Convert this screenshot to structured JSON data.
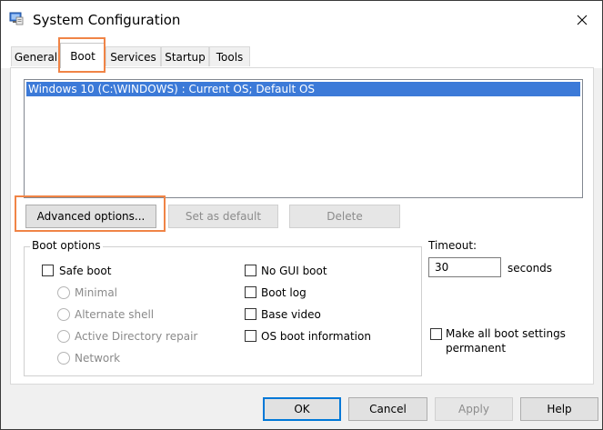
{
  "window": {
    "title": "System Configuration",
    "app_icon": "msconfig-icon",
    "close_icon": "close-icon"
  },
  "tabs": [
    {
      "label": "General",
      "active": false
    },
    {
      "label": "Boot",
      "active": true
    },
    {
      "label": "Services",
      "active": false
    },
    {
      "label": "Startup",
      "active": false
    },
    {
      "label": "Tools",
      "active": false
    }
  ],
  "os_list": {
    "entries": [
      "Windows 10 (C:\\WINDOWS) : Current OS; Default OS"
    ],
    "selected_index": 0
  },
  "buttons": {
    "advanced": "Advanced options...",
    "set_default": "Set as default",
    "delete": "Delete"
  },
  "boot_options": {
    "label": "Boot options",
    "safe_boot": {
      "label": "Safe boot",
      "checked": false
    },
    "radios": [
      {
        "label": "Minimal",
        "enabled": false
      },
      {
        "label": "Alternate shell",
        "enabled": false
      },
      {
        "label": "Active Directory repair",
        "enabled": false
      },
      {
        "label": "Network",
        "enabled": false
      }
    ],
    "right_checks": [
      {
        "label": "No GUI boot",
        "checked": false
      },
      {
        "label": "Boot log",
        "checked": false
      },
      {
        "label": "Base video",
        "checked": false
      },
      {
        "label": "OS boot information",
        "checked": false
      }
    ]
  },
  "timeout": {
    "label": "Timeout:",
    "value": "30",
    "unit": "seconds"
  },
  "permanent": {
    "line1": "Make all boot settings",
    "line2": "permanent",
    "checked": false
  },
  "footer": {
    "ok": "OK",
    "cancel": "Cancel",
    "apply": "Apply",
    "help": "Help"
  },
  "colors": {
    "highlight": "#f08446",
    "selection": "#3c7ad8",
    "accent": "#0078d7"
  }
}
